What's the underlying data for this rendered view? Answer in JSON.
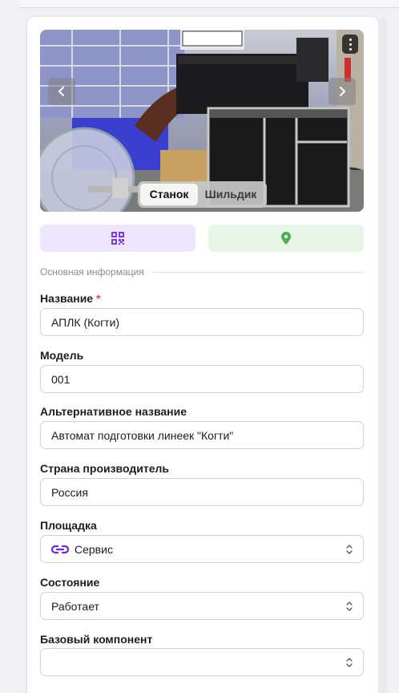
{
  "gallery": {
    "tabs": [
      "Станок",
      "Шильдик"
    ],
    "active_tab": "Станок"
  },
  "actions": {
    "qr_icon": "qr-code-icon",
    "location_icon": "map-pin-icon",
    "accent_purple": "#7c3aed",
    "accent_green": "#4caf50"
  },
  "section": {
    "title": "Основная информация"
  },
  "form": {
    "name": {
      "label": "Название",
      "required_mark": "*",
      "value": "АПЛК (Когти)"
    },
    "model": {
      "label": "Модель",
      "value": "001"
    },
    "alt_name": {
      "label": "Альтернативное название",
      "value": "Автомат подготовки линеек \"Когти\""
    },
    "country": {
      "label": "Страна производитель",
      "value": "Россия"
    },
    "site": {
      "label": "Площадка",
      "value": "Сервис",
      "icon": "link-icon"
    },
    "state": {
      "label": "Состояние",
      "value": "Работает"
    },
    "base_component": {
      "label": "Базовый компонент",
      "value": ""
    }
  }
}
